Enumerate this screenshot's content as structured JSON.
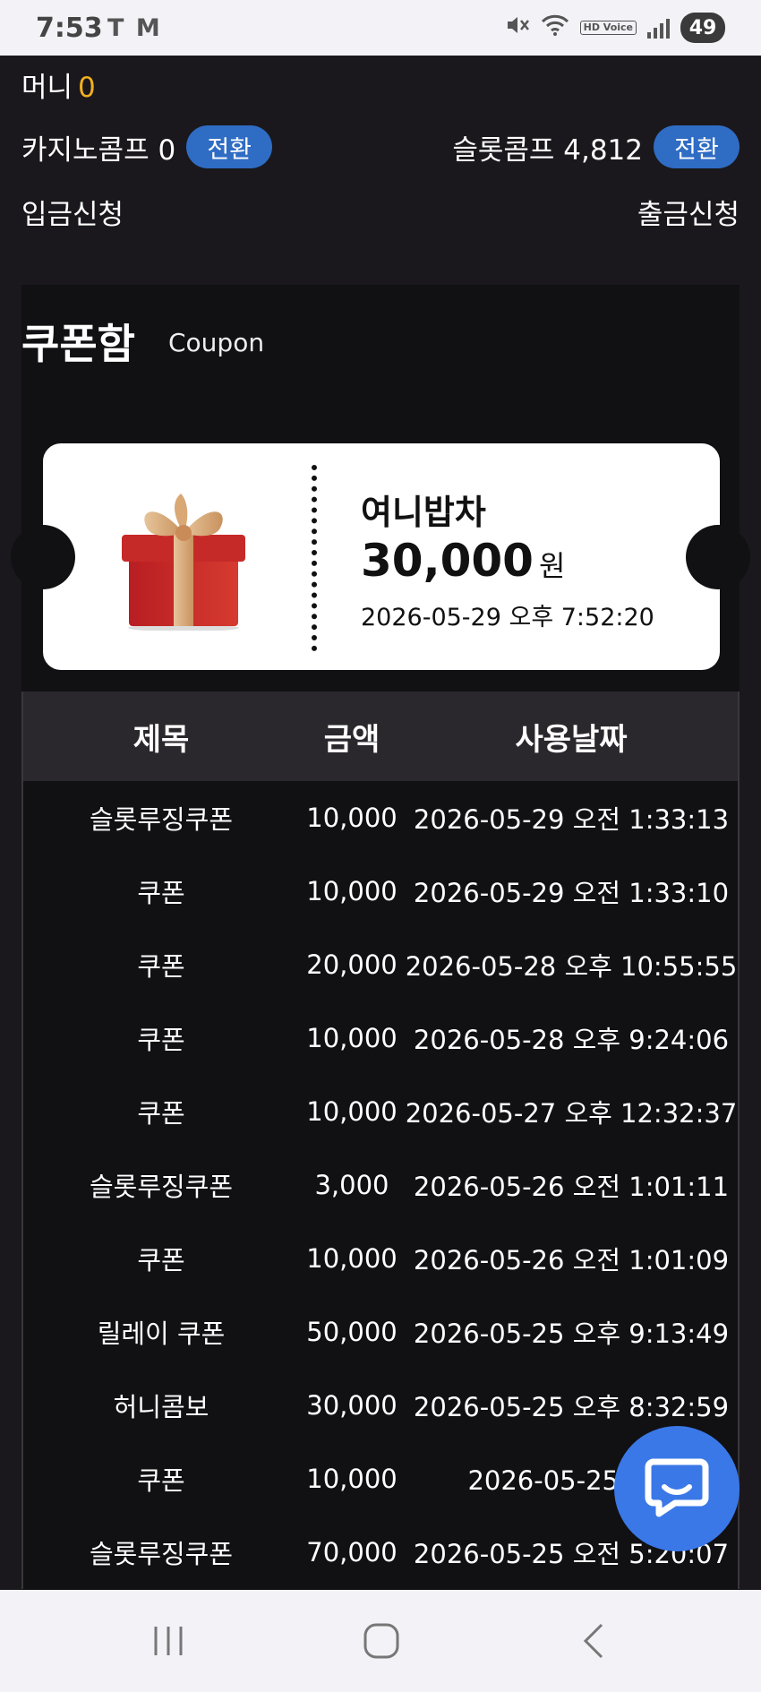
{
  "status_bar": {
    "time": "7:53",
    "left_icons": "T M",
    "hd_label": "HD Voice",
    "battery": "49",
    "icons": [
      "mute-icon",
      "wifi-icon",
      "hd-voice-icon",
      "signal-icon",
      "battery-icon"
    ]
  },
  "account": {
    "money_label": "머니",
    "money_value": "0",
    "casino_comp_label": "카지노콤프 0",
    "slot_comp_label": "슬롯콤프 4,812",
    "convert_label": "전환",
    "deposit_label": "입금신청",
    "withdraw_label": "출금신청"
  },
  "coupon_box": {
    "title": "쿠폰함",
    "subtitle": "Coupon",
    "featured": {
      "name": "여니밥차",
      "amount": "30,000",
      "unit": "원",
      "date": "2026-05-29 오후 7:52:20"
    }
  },
  "table": {
    "headers": [
      "제목",
      "금액",
      "사용날짜"
    ],
    "rows": [
      [
        "슬롯루징쿠폰",
        "10,000",
        "2026-05-29 오전 1:33:13"
      ],
      [
        "쿠폰",
        "10,000",
        "2026-05-29 오전 1:33:10"
      ],
      [
        "쿠폰",
        "20,000",
        "2026-05-28 오후 10:55:55"
      ],
      [
        "쿠폰",
        "10,000",
        "2026-05-28 오후 9:24:06"
      ],
      [
        "쿠폰",
        "10,000",
        "2026-05-27 오후 12:32:37"
      ],
      [
        "슬롯루징쿠폰",
        "3,000",
        "2026-05-26 오전 1:01:11"
      ],
      [
        "쿠폰",
        "10,000",
        "2026-05-26 오전 1:01:09"
      ],
      [
        "릴레이 쿠폰",
        "50,000",
        "2026-05-25 오후 9:13:49"
      ],
      [
        "허니콤보",
        "30,000",
        "2026-05-25 오후 8:32:59"
      ],
      [
        "쿠폰",
        "10,000",
        "2026-05-25 오전"
      ],
      [
        "슬롯루징쿠폰",
        "70,000",
        "2026-05-25 오전 5:20:07"
      ]
    ]
  },
  "colors": {
    "background": "#1a181c",
    "panel": "#111013",
    "accent_blue": "#2f6cc4",
    "money_gold": "#f0b020",
    "chat_blue": "#3a78e8"
  },
  "nav": {
    "icons": [
      "recent-apps-icon",
      "home-icon",
      "back-icon"
    ]
  }
}
